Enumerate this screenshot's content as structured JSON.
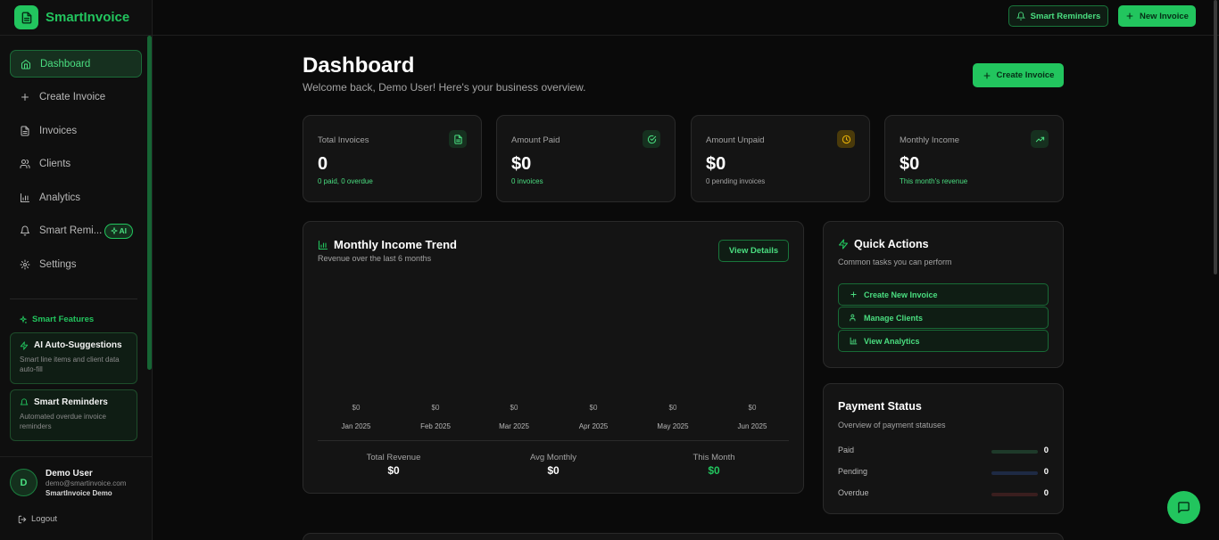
{
  "brand": {
    "name": "SmartInvoice"
  },
  "sidebar": {
    "items": [
      {
        "label": "Dashboard",
        "icon": "home-icon"
      },
      {
        "label": "Create Invoice",
        "icon": "plus-icon"
      },
      {
        "label": "Invoices",
        "icon": "file-icon"
      },
      {
        "label": "Clients",
        "icon": "users-icon"
      },
      {
        "label": "Analytics",
        "icon": "bar-chart-icon"
      },
      {
        "label": "Smart Remi...",
        "icon": "bell-icon",
        "badge": "AI"
      },
      {
        "label": "Settings",
        "icon": "gear-icon"
      }
    ],
    "smart_features_title": "Smart Features",
    "features": [
      {
        "title": "AI Auto-Suggestions",
        "desc": "Smart line items and client data auto-fill"
      },
      {
        "title": "Smart Reminders",
        "desc": "Automated overdue invoice reminders"
      }
    ],
    "user": {
      "initial": "D",
      "name": "Demo User",
      "email": "demo@smartinvoice.com",
      "org": "SmartInvoice Demo"
    },
    "logout_label": "Logout"
  },
  "topbar": {
    "reminders_label": "Smart Reminders",
    "new_invoice_label": "New Invoice"
  },
  "page": {
    "title": "Dashboard",
    "subtitle": "Welcome back, Demo User! Here's your business overview.",
    "create_invoice_label": "Create Invoice"
  },
  "stats": [
    {
      "label": "Total Invoices",
      "value": "0",
      "foot": "0 paid, 0 overdue",
      "icon": "file-icon",
      "accent": "#22c55e"
    },
    {
      "label": "Amount Paid",
      "value": "$0",
      "foot": "0 invoices",
      "icon": "check-circle-icon",
      "accent": "#22c55e"
    },
    {
      "label": "Amount Unpaid",
      "value": "$0",
      "foot": "0 pending invoices",
      "icon": "clock-icon",
      "accent": "#eab308"
    },
    {
      "label": "Monthly Income",
      "value": "$0",
      "foot": "This month's revenue",
      "icon": "trending-up-icon",
      "accent": "#22c55e"
    }
  ],
  "income_trend": {
    "title": "Monthly Income Trend",
    "subtitle": "Revenue over the last 6 months",
    "view_details_label": "View Details",
    "months": [
      {
        "label": "Jan 2025",
        "value": "$0"
      },
      {
        "label": "Feb 2025",
        "value": "$0"
      },
      {
        "label": "Mar 2025",
        "value": "$0"
      },
      {
        "label": "Apr 2025",
        "value": "$0"
      },
      {
        "label": "May 2025",
        "value": "$0"
      },
      {
        "label": "Jun 2025",
        "value": "$0"
      }
    ],
    "summary": [
      {
        "label": "Total Revenue",
        "value": "$0"
      },
      {
        "label": "Avg Monthly",
        "value": "$0"
      },
      {
        "label": "This Month",
        "value": "$0"
      }
    ]
  },
  "quick_actions": {
    "title": "Quick Actions",
    "subtitle": "Common tasks you can perform",
    "actions": [
      {
        "label": "Create New Invoice",
        "icon": "plus-icon"
      },
      {
        "label": "Manage Clients",
        "icon": "users-icon"
      },
      {
        "label": "View Analytics",
        "icon": "bar-chart-icon"
      }
    ]
  },
  "payment_status": {
    "title": "Payment Status",
    "subtitle": "Overview of payment statuses",
    "rows": [
      {
        "label": "Paid",
        "count": "0",
        "color": "#1e3a2a"
      },
      {
        "label": "Pending",
        "count": "0",
        "color": "#1e2a44"
      },
      {
        "label": "Overdue",
        "count": "0",
        "color": "#3a1e1e"
      }
    ]
  },
  "colors": {
    "accent": "#22c55e",
    "background": "#0a0a0a",
    "card": "#141414"
  }
}
